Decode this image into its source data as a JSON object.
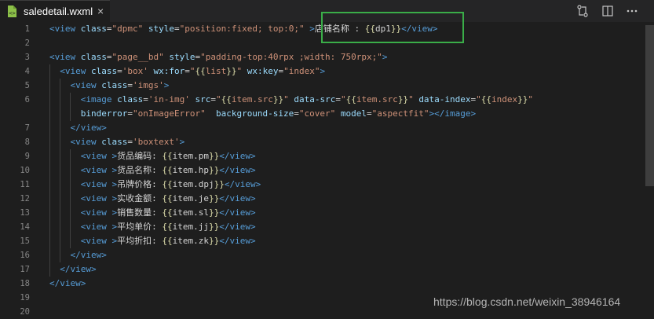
{
  "tab": {
    "filename": "saledetail.wxml",
    "close": "×"
  },
  "toolbar_icons": [
    "compare-changes-icon",
    "split-editor-icon",
    "more-actions-icon"
  ],
  "line_numbers": [
    "1",
    "2",
    "3",
    "4",
    "5",
    "6",
    "",
    "7",
    "8",
    "9",
    "10",
    "11",
    "12",
    "13",
    "14",
    "15",
    "16",
    "17",
    "18",
    "19",
    "20"
  ],
  "code": [
    [
      [
        "t",
        "<view"
      ],
      [
        "p",
        " "
      ],
      [
        "a",
        "class"
      ],
      [
        "p",
        "="
      ],
      [
        "s",
        "\"dpmc\""
      ],
      [
        "p",
        " "
      ],
      [
        "a",
        "style"
      ],
      [
        "p",
        "="
      ],
      [
        "s",
        "\"position:fixed; top:0;\""
      ],
      [
        "p",
        " "
      ],
      [
        "t",
        ">"
      ],
      [
        "p",
        "店铺名称 : "
      ],
      [
        "m",
        "{{"
      ],
      [
        "p",
        "dp1"
      ],
      [
        "m",
        "}}"
      ],
      [
        "t",
        "</view>"
      ]
    ],
    [],
    [
      [
        "t",
        "<view"
      ],
      [
        "p",
        " "
      ],
      [
        "a",
        "class"
      ],
      [
        "p",
        "="
      ],
      [
        "s",
        "\"page__bd\""
      ],
      [
        "p",
        " "
      ],
      [
        "a",
        "style"
      ],
      [
        "p",
        "="
      ],
      [
        "s",
        "\"padding-top:40rpx ;width: 750rpx;\""
      ],
      [
        "t",
        ">"
      ]
    ],
    [
      [
        "p",
        "  "
      ],
      [
        "t",
        "<view"
      ],
      [
        "p",
        " "
      ],
      [
        "a",
        "class"
      ],
      [
        "p",
        "="
      ],
      [
        "s",
        "'box'"
      ],
      [
        "p",
        " "
      ],
      [
        "a",
        "wx:for"
      ],
      [
        "p",
        "="
      ],
      [
        "s",
        "\""
      ],
      [
        "m",
        "{{"
      ],
      [
        "s",
        "list"
      ],
      [
        "m",
        "}}"
      ],
      [
        "s",
        "\""
      ],
      [
        "p",
        " "
      ],
      [
        "a",
        "wx:key"
      ],
      [
        "p",
        "="
      ],
      [
        "s",
        "\"index\""
      ],
      [
        "t",
        ">"
      ]
    ],
    [
      [
        "p",
        "    "
      ],
      [
        "t",
        "<view"
      ],
      [
        "p",
        " "
      ],
      [
        "a",
        "class"
      ],
      [
        "p",
        "="
      ],
      [
        "s",
        "'imgs'"
      ],
      [
        "t",
        ">"
      ]
    ],
    [
      [
        "p",
        "      "
      ],
      [
        "t",
        "<image"
      ],
      [
        "p",
        " "
      ],
      [
        "a",
        "class"
      ],
      [
        "p",
        "="
      ],
      [
        "s",
        "'in-img'"
      ],
      [
        "p",
        " "
      ],
      [
        "a",
        "src"
      ],
      [
        "p",
        "="
      ],
      [
        "s",
        "\""
      ],
      [
        "m",
        "{{"
      ],
      [
        "s",
        "item.src"
      ],
      [
        "m",
        "}}"
      ],
      [
        "s",
        "\""
      ],
      [
        "p",
        " "
      ],
      [
        "a",
        "data-src"
      ],
      [
        "p",
        "="
      ],
      [
        "s",
        "\""
      ],
      [
        "m",
        "{{"
      ],
      [
        "s",
        "item.src"
      ],
      [
        "m",
        "}}"
      ],
      [
        "s",
        "\""
      ],
      [
        "p",
        " "
      ],
      [
        "a",
        "data-index"
      ],
      [
        "p",
        "="
      ],
      [
        "s",
        "\""
      ],
      [
        "m",
        "{{"
      ],
      [
        "s",
        "index"
      ],
      [
        "m",
        "}}"
      ],
      [
        "s",
        "\""
      ]
    ],
    [
      [
        "p",
        "      "
      ],
      [
        "a",
        "binderror"
      ],
      [
        "p",
        "="
      ],
      [
        "s",
        "\"onImageError\""
      ],
      [
        "p",
        "  "
      ],
      [
        "a",
        "background-size"
      ],
      [
        "p",
        "="
      ],
      [
        "s",
        "\"cover\""
      ],
      [
        "p",
        " "
      ],
      [
        "a",
        "model"
      ],
      [
        "p",
        "="
      ],
      [
        "s",
        "\"aspectfit\""
      ],
      [
        "t",
        ">"
      ],
      [
        "t",
        "</image>"
      ]
    ],
    [
      [
        "p",
        "    "
      ],
      [
        "t",
        "</view>"
      ]
    ],
    [
      [
        "p",
        "    "
      ],
      [
        "t",
        "<view"
      ],
      [
        "p",
        " "
      ],
      [
        "a",
        "class"
      ],
      [
        "p",
        "="
      ],
      [
        "s",
        "'boxtext'"
      ],
      [
        "t",
        ">"
      ]
    ],
    [
      [
        "p",
        "      "
      ],
      [
        "t",
        "<view"
      ],
      [
        "p",
        " "
      ],
      [
        "t",
        ">"
      ],
      [
        "p",
        "货品编码: "
      ],
      [
        "m",
        "{{"
      ],
      [
        "p",
        "item.pm"
      ],
      [
        "m",
        "}}"
      ],
      [
        "t",
        "</view>"
      ]
    ],
    [
      [
        "p",
        "      "
      ],
      [
        "t",
        "<view"
      ],
      [
        "p",
        " "
      ],
      [
        "t",
        ">"
      ],
      [
        "p",
        "货品名称: "
      ],
      [
        "m",
        "{{"
      ],
      [
        "p",
        "item.hp"
      ],
      [
        "m",
        "}}"
      ],
      [
        "t",
        "</view>"
      ]
    ],
    [
      [
        "p",
        "      "
      ],
      [
        "t",
        "<view"
      ],
      [
        "p",
        " "
      ],
      [
        "t",
        ">"
      ],
      [
        "p",
        "吊牌价格: "
      ],
      [
        "m",
        "{{"
      ],
      [
        "p",
        "item.dpj"
      ],
      [
        "m",
        "}}"
      ],
      [
        "t",
        "</view>"
      ]
    ],
    [
      [
        "p",
        "      "
      ],
      [
        "t",
        "<view"
      ],
      [
        "p",
        " "
      ],
      [
        "t",
        ">"
      ],
      [
        "p",
        "实收金额: "
      ],
      [
        "m",
        "{{"
      ],
      [
        "p",
        "item.je"
      ],
      [
        "m",
        "}}"
      ],
      [
        "t",
        "</view>"
      ]
    ],
    [
      [
        "p",
        "      "
      ],
      [
        "t",
        "<view"
      ],
      [
        "p",
        " "
      ],
      [
        "t",
        ">"
      ],
      [
        "p",
        "销售数量: "
      ],
      [
        "m",
        "{{"
      ],
      [
        "p",
        "item.sl"
      ],
      [
        "m",
        "}}"
      ],
      [
        "t",
        "</view>"
      ]
    ],
    [
      [
        "p",
        "      "
      ],
      [
        "t",
        "<view"
      ],
      [
        "p",
        " "
      ],
      [
        "t",
        ">"
      ],
      [
        "p",
        "平均单价: "
      ],
      [
        "m",
        "{{"
      ],
      [
        "p",
        "item.jj"
      ],
      [
        "m",
        "}}"
      ],
      [
        "t",
        "</view>"
      ]
    ],
    [
      [
        "p",
        "      "
      ],
      [
        "t",
        "<view"
      ],
      [
        "p",
        " "
      ],
      [
        "t",
        ">"
      ],
      [
        "p",
        "平均折扣: "
      ],
      [
        "m",
        "{{"
      ],
      [
        "p",
        "item.zk"
      ],
      [
        "m",
        "}}"
      ],
      [
        "t",
        "</view>"
      ]
    ],
    [
      [
        "p",
        "    "
      ],
      [
        "t",
        "</view>"
      ]
    ],
    [
      [
        "p",
        "  "
      ],
      [
        "t",
        "</view>"
      ]
    ],
    [
      [
        "t",
        "</view>"
      ]
    ],
    [],
    []
  ],
  "watermark": "https://blog.csdn.net/weixin_38946164"
}
